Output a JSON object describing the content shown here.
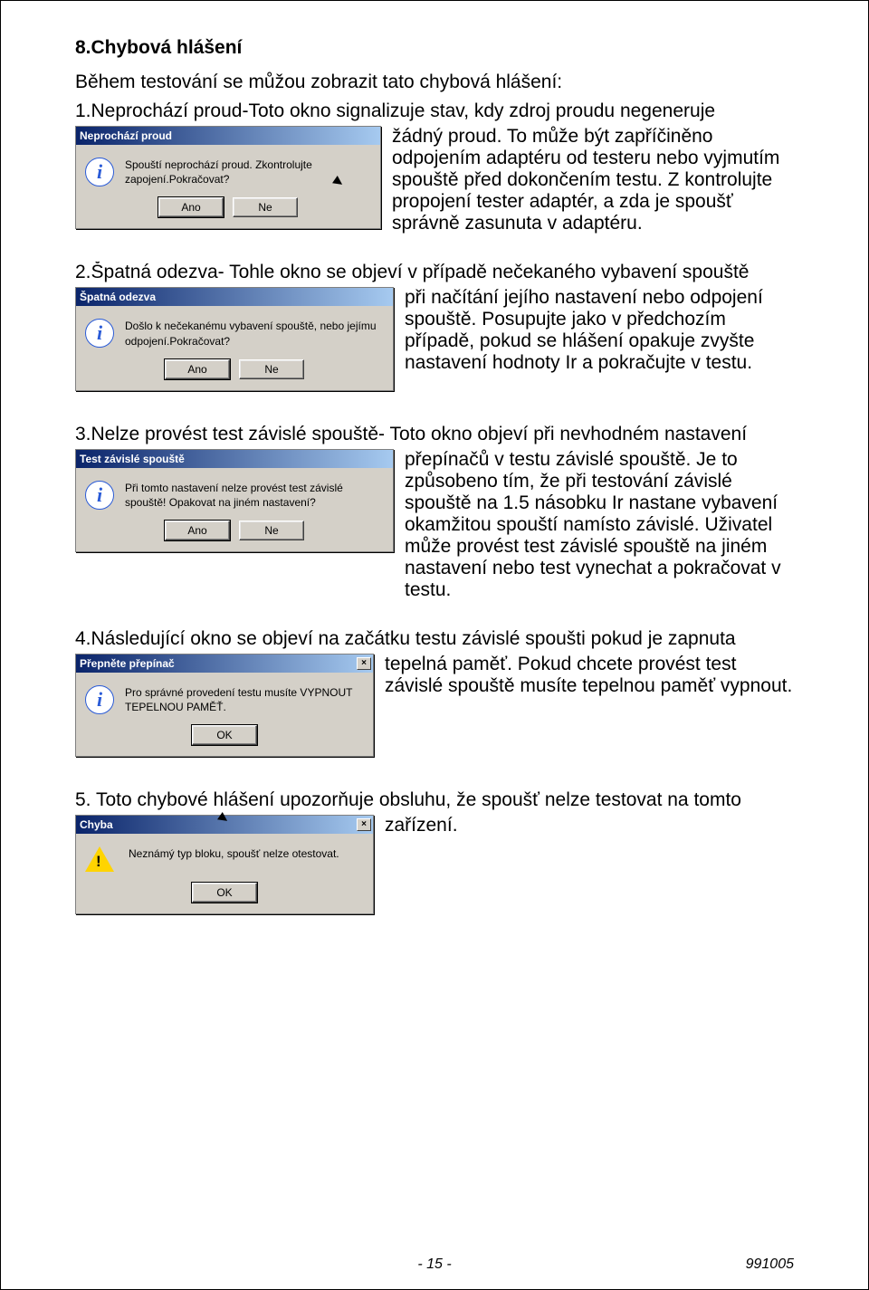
{
  "doc": {
    "section_title": "8.Chybová hlášení",
    "intro": "Během testování se můžou zobrazit tato chybová hlášení:",
    "items": [
      {
        "lead": "1.Neprochází proud-Toto okno signalizuje stav, kdy zdroj proudu negeneruje",
        "aside": "žádný proud. To může být zapříčiněno odpojením adaptéru od testeru nebo vyjmutím spouště před dokončením testu. Z kontrolujte propojení tester adaptér, a zda je spoušť správně zasunuta v adaptéru.",
        "dialog": {
          "title": "Neprochází proud",
          "msg": "Spouští neprochází proud. Zkontrolujte zapojení.Pokračovat?",
          "icon": "info",
          "buttons": [
            "Ano",
            "Ne"
          ],
          "has_close": false,
          "has_cursor": true
        }
      },
      {
        "lead": "2.Špatná odezva- Tohle okno se objeví v případě nečekaného vybavení spouště",
        "aside": "při načítání jejího nastavení nebo odpojení spouště. Posupujte jako v předchozím případě, pokud se hlášení opakuje zvyšte nastavení hodnoty Ir a pokračujte v testu.",
        "dialog": {
          "title": "Špatná odezva",
          "msg": "Došlo k nečekanému vybavení spouště, nebo jejímu odpojení.Pokračovat?",
          "icon": "info",
          "buttons": [
            "Ano",
            "Ne"
          ],
          "has_close": false,
          "has_cursor": false
        }
      },
      {
        "lead": "3.Nelze provést test závislé spouště- Toto okno objeví při nevhodném nastavení",
        "aside": "přepínačů v testu závislé spouště. Je to způsobeno tím, že při testování závislé spouště na 1.5 násobku Ir nastane vybavení okamžitou spouští namísto závislé. Uživatel může provést test závislé spouště na jiném nastavení nebo test vynechat a pokračovat v testu.",
        "dialog": {
          "title": "Test závislé spouště",
          "msg": "Při tomto nastavení nelze provést test závislé spouště! Opakovat na jiném nastavení?",
          "icon": "info",
          "buttons": [
            "Ano",
            "Ne"
          ],
          "has_close": false,
          "has_cursor": false
        }
      },
      {
        "lead": "4.Následující okno se objeví na začátku testu závislé spoušti pokud je zapnuta",
        "aside": "tepelná paměť. Pokud chcete provést test závislé spouště musíte tepelnou paměť vypnout.",
        "dialog": {
          "title": "Přepněte přepínač",
          "msg": "Pro správné provedení testu musíte VYPNOUT TEPELNOU PAMĚŤ.",
          "icon": "info",
          "buttons": [
            "OK"
          ],
          "has_close": true,
          "has_cursor": false
        }
      },
      {
        "lead": "5. Toto chybové hlášení upozorňuje obsluhu, že spoušť nelze testovat na tomto",
        "aside": "zařízení.",
        "dialog": {
          "title": "Chyba",
          "msg": "Neznámý typ bloku,  spoušť nelze otestovat.",
          "icon": "warn",
          "buttons": [
            "OK"
          ],
          "has_close": true,
          "has_cursor": true
        }
      }
    ],
    "footer": {
      "page": "- 15 -",
      "code": "991005"
    }
  }
}
